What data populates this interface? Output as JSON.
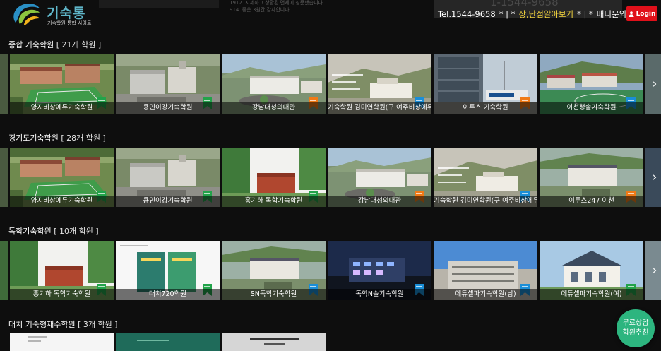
{
  "header": {
    "logo_title": "기숙통",
    "logo_subtitle": "기숙학원 통합 사이트",
    "notices": [
      "1912. 시제하고 상황된 면세에 심문했습니다.",
      "914. 좋은 3원간 감사합니다."
    ],
    "phone_ghost": "1-1544-9658",
    "nav": {
      "tel": "Tel.1544-9658",
      "sep1": "* | *",
      "consult": "장,단점알아보기",
      "sep2": "* | *",
      "banner": "배너문의"
    },
    "login_label": "Login"
  },
  "sections": [
    {
      "title": "종합 기숙학원",
      "count": "[ 21개 학원 ]",
      "cards": [
        {
          "name": "양지비상에듀기숙학원",
          "badge": "green"
        },
        {
          "name": "용인이강기숙학원",
          "badge": "green"
        },
        {
          "name": "강남대성의대관",
          "badge": "orange"
        },
        {
          "name": "기숙학원 김미연학원(구 여주비상에듀)",
          "badge": "blue"
        },
        {
          "name": "이투스 기숙학원",
          "badge": "orange"
        },
        {
          "name": "이천청솔기숙학원",
          "badge": "blue"
        }
      ]
    },
    {
      "title": "경기도기숙학원",
      "count": "[ 28개 학원 ]",
      "cards": [
        {
          "name": "양지비상에듀기숙학원",
          "badge": "green"
        },
        {
          "name": "용인이강기숙학원",
          "badge": "green"
        },
        {
          "name": "홍기하 독학기숙학원",
          "badge": "green"
        },
        {
          "name": "강남대성의대관",
          "badge": "orange"
        },
        {
          "name": "기숙학원 김미연학원(구 여주비상에듀)",
          "badge": "blue"
        },
        {
          "name": "이투스247 이천",
          "badge": "orange"
        }
      ]
    },
    {
      "title": "독학기숙학원",
      "count": "[ 10개 학원 ]",
      "cards": [
        {
          "name": "홍기하 독학기숙학원",
          "badge": "green"
        },
        {
          "name": "대치720학원",
          "badge": "green"
        },
        {
          "name": "SN독학기숙학원",
          "badge": "blue"
        },
        {
          "name": "독학N솔기숙학원",
          "badge": "blue"
        },
        {
          "name": "에듀셀파기숙학원(남)",
          "badge": "blue"
        },
        {
          "name": "에듀셀파기숙학원(여)",
          "badge": "green"
        }
      ]
    },
    {
      "title": "대치 기숙형재수학원",
      "count": "[ 3개 학원 ]",
      "cards": []
    }
  ],
  "badge_colors": {
    "green": "#22a34a",
    "orange": "#f07a16",
    "blue": "#1a8ed8"
  },
  "floating": {
    "line1": "무료상담",
    "line2": "학원추천"
  },
  "icons": [
    "logo-mark-icon",
    "user-icon",
    "chevron-right-icon",
    "bookmark-badge-icon"
  ]
}
